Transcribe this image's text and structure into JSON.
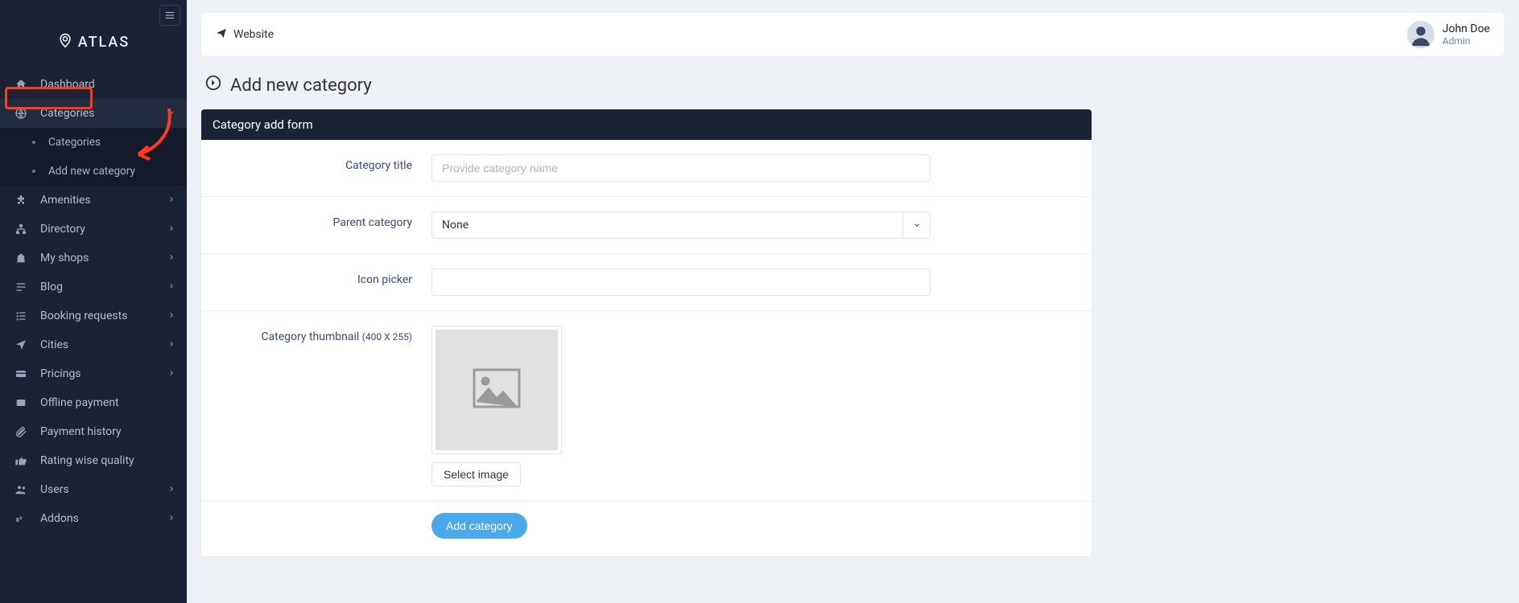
{
  "brand": "ATLAS",
  "topbar": {
    "website": "Website"
  },
  "user": {
    "name": "John Doe",
    "role": "Admin"
  },
  "page": {
    "title": "Add new category"
  },
  "card": {
    "header": "Category add form"
  },
  "form": {
    "category_title_label": "Category title",
    "category_title_placeholder": "Provide category name",
    "parent_label": "Parent category",
    "parent_value": "None",
    "icon_picker_label": "Icon picker",
    "thumb_label": "Category thumbnail ",
    "thumb_hint": "(400 X 255)",
    "select_image": "Select image",
    "submit": "Add category"
  },
  "sidebar": {
    "items": [
      {
        "label": "Dashboard"
      },
      {
        "label": "Categories"
      },
      {
        "label": "Amenities"
      },
      {
        "label": "Directory"
      },
      {
        "label": "My shops"
      },
      {
        "label": "Blog"
      },
      {
        "label": "Booking requests"
      },
      {
        "label": "Cities"
      },
      {
        "label": "Pricings"
      },
      {
        "label": "Offline payment"
      },
      {
        "label": "Payment history"
      },
      {
        "label": "Rating wise quality"
      },
      {
        "label": "Users"
      },
      {
        "label": "Addons"
      }
    ],
    "sub": [
      {
        "label": "Categories"
      },
      {
        "label": "Add new category"
      }
    ]
  }
}
